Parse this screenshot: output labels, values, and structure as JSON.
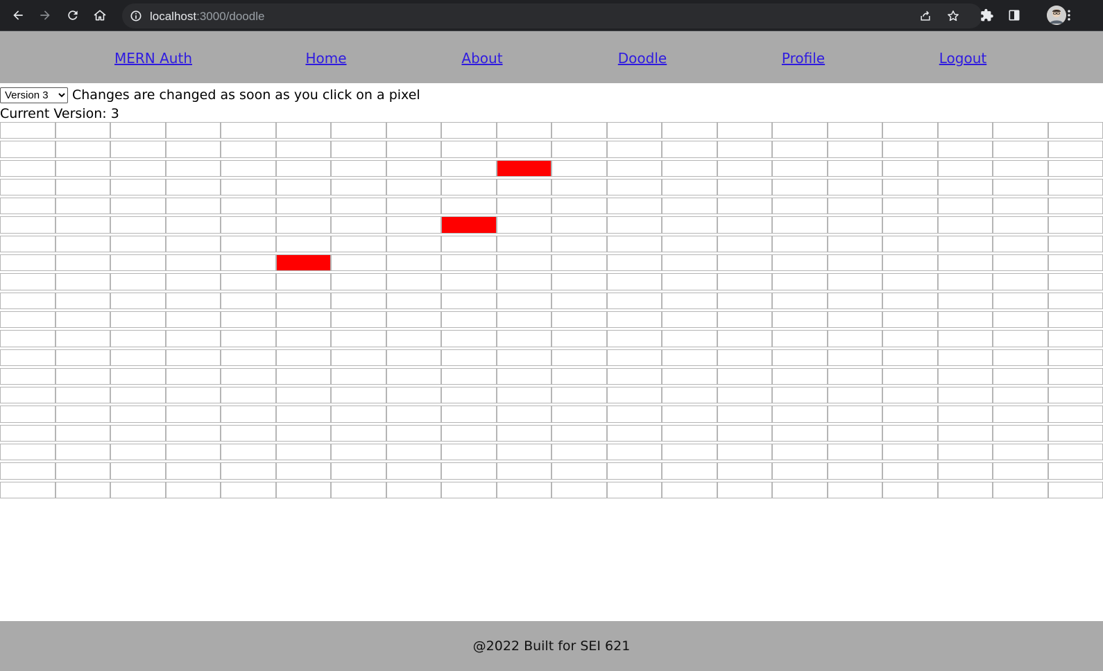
{
  "browser": {
    "url_host": "localhost",
    "url_path": ":3000/doodle",
    "icons": [
      "back-icon",
      "forward-icon",
      "reload-icon",
      "home-icon",
      "info-icon",
      "share-icon",
      "star-icon",
      "extensions-icon",
      "sidepanel-icon",
      "avatar",
      "menu-icon"
    ]
  },
  "nav": {
    "links": [
      "MERN Auth",
      "Home",
      "About",
      "Doodle",
      "Profile",
      "Logout"
    ],
    "link_color": "#2f1be0",
    "background": "#aaaaaa"
  },
  "doodle": {
    "version_options": [
      "Version 3"
    ],
    "selected_version": "Version 3",
    "hint": "Changes are changed as soon as you click on a pixel",
    "current_version_label": "Current Version: 3",
    "columns": 20,
    "rows": 20,
    "filled_color": "#ff0000",
    "filled_cells": [
      {
        "row": 2,
        "col": 9
      },
      {
        "row": 5,
        "col": 8
      },
      {
        "row": 7,
        "col": 5
      }
    ]
  },
  "footer": {
    "text": "@2022 Built for SEI 621"
  }
}
